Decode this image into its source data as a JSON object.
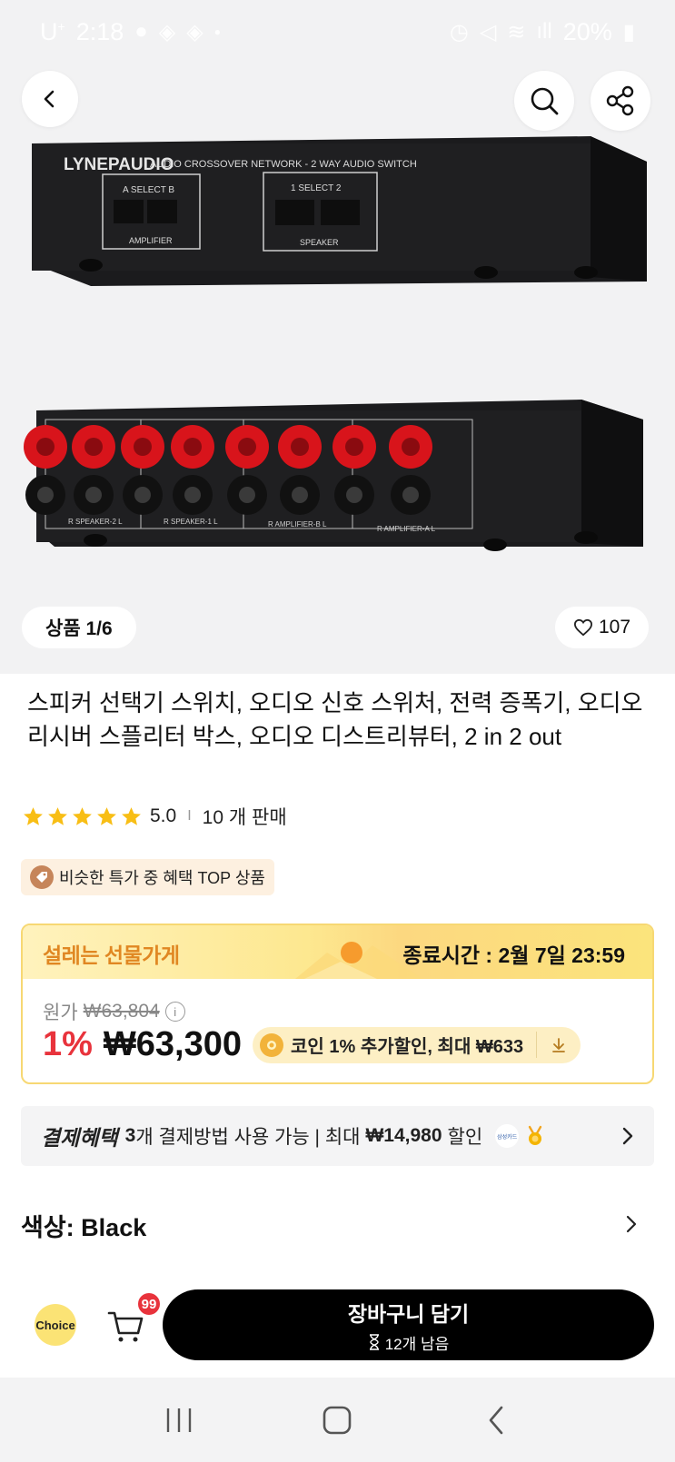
{
  "status_bar": {
    "carrier": "U",
    "time": "2:18",
    "battery": "20%"
  },
  "gallery": {
    "counter": "상품 1/6",
    "wishlist_count": "107"
  },
  "product": {
    "title": "스피커 선택기 스위치, 오디오 신호 스위처, 전력 증폭기, 오디오 리시버 스플리터 박스, 오디오 디스트리뷰터, 2 in 2 out",
    "rating": "5.0",
    "sold": "10 개 판매",
    "rating_separator": "I",
    "tag": "비슷한 특가 중 혜택 TOP 상품",
    "image_text": {
      "brand": "LYNEPAUDIO",
      "model": "AUDIO CROSSOVER NETWORK - 2 WAY AUDIO SWITCH",
      "select_ab": "A  SELECT  B",
      "amplifier": "AMPLIFIER",
      "select_12": "1  SELECT  2",
      "speaker": "SPEAKER",
      "rear_labels": [
        "R  SPEAKER-2  L",
        "R  SPEAKER-1  L",
        "R  AMPLIFIER-B  L",
        "R  AMPLIFIER-A  L"
      ]
    }
  },
  "promo": {
    "title": "설레는 선물가게",
    "end_time": "종료시간 :  2월 7일 23:59",
    "original_label": "원가",
    "original_price": "₩63,804",
    "discount": "1%",
    "price": "₩63,300",
    "coin_text": "코인 1% 추가할인, 최대 ₩633"
  },
  "payment": {
    "label": "결제혜택",
    "count": "3",
    "text": "개 결제방법 사용 가능 | 최대 ",
    "max_amount": "₩14,980",
    "suffix": " 할인",
    "samsung_logo": "삼성카드"
  },
  "option": {
    "color_label": "색상: Black"
  },
  "bottom_bar": {
    "choice": "Choice",
    "cart_badge": "99",
    "cta_label": "장바구니 담기",
    "cta_sub": "12개 남음"
  },
  "colors": {
    "accent_red": "#e8333c",
    "promo_orange": "#e08722",
    "promo_yellow": "#f7d873",
    "cta_black": "#000000"
  }
}
